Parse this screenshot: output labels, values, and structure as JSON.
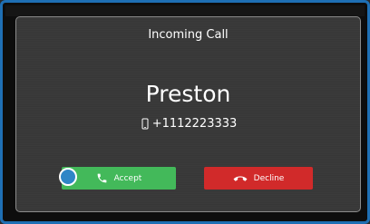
{
  "dialog": {
    "title": "Incoming Call",
    "caller_name": "Preston",
    "caller_number": "+1112223333",
    "number_icon": "mobile-phone-icon"
  },
  "buttons": {
    "accept_label": "Accept",
    "accept_icon": "phone-handset-icon",
    "decline_label": "Decline",
    "decline_icon": "hang-up-icon"
  },
  "colors": {
    "accept": "#43b95a",
    "decline": "#d12a2a",
    "focus": "#2f86c6",
    "frame_border": "#1e6fb4"
  }
}
